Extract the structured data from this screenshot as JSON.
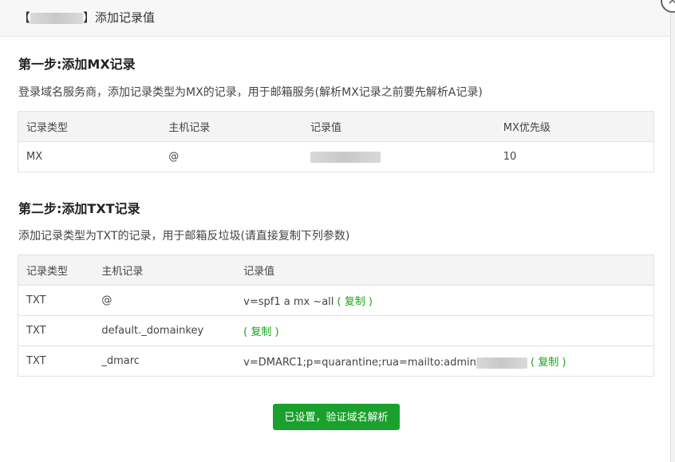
{
  "dialog": {
    "title_open": "【",
    "title_close": "】",
    "title": "添加记录值",
    "close_glyph": "✕"
  },
  "step1": {
    "title": "第一步:添加MX记录",
    "desc": "登录域名服务商，添加记录类型为MX的记录，用于邮箱服务(解析MX记录之前要先解析A记录)",
    "headers": [
      "记录类型",
      "主机记录",
      "记录值",
      "MX优先级"
    ],
    "row": {
      "type": "MX",
      "host": "@",
      "value": "",
      "priority": "10"
    }
  },
  "step2": {
    "title": "第二步:添加TXT记录",
    "desc": "添加记录类型为TXT的记录，用于邮箱反垃圾(请直接复制下列参数)",
    "headers": [
      "记录类型",
      "主机记录",
      "记录值"
    ],
    "rows": [
      {
        "type": "TXT",
        "host": "@",
        "value": "v=spf1 a mx ~all",
        "copy": "( 复制 )"
      },
      {
        "type": "TXT",
        "host": "default._domainkey",
        "value": "",
        "copy": "( 复制 )"
      },
      {
        "type": "TXT",
        "host": "_dmarc",
        "value": "v=DMARC1;p=quarantine;rua=mailto:admin",
        "copy": "( 复制 )"
      }
    ]
  },
  "verify_button": "已设置，验证域名解析",
  "colors": {
    "accent": "#1aa02c",
    "link": "#1aa51a",
    "header_bg": "#f7f7f7"
  }
}
